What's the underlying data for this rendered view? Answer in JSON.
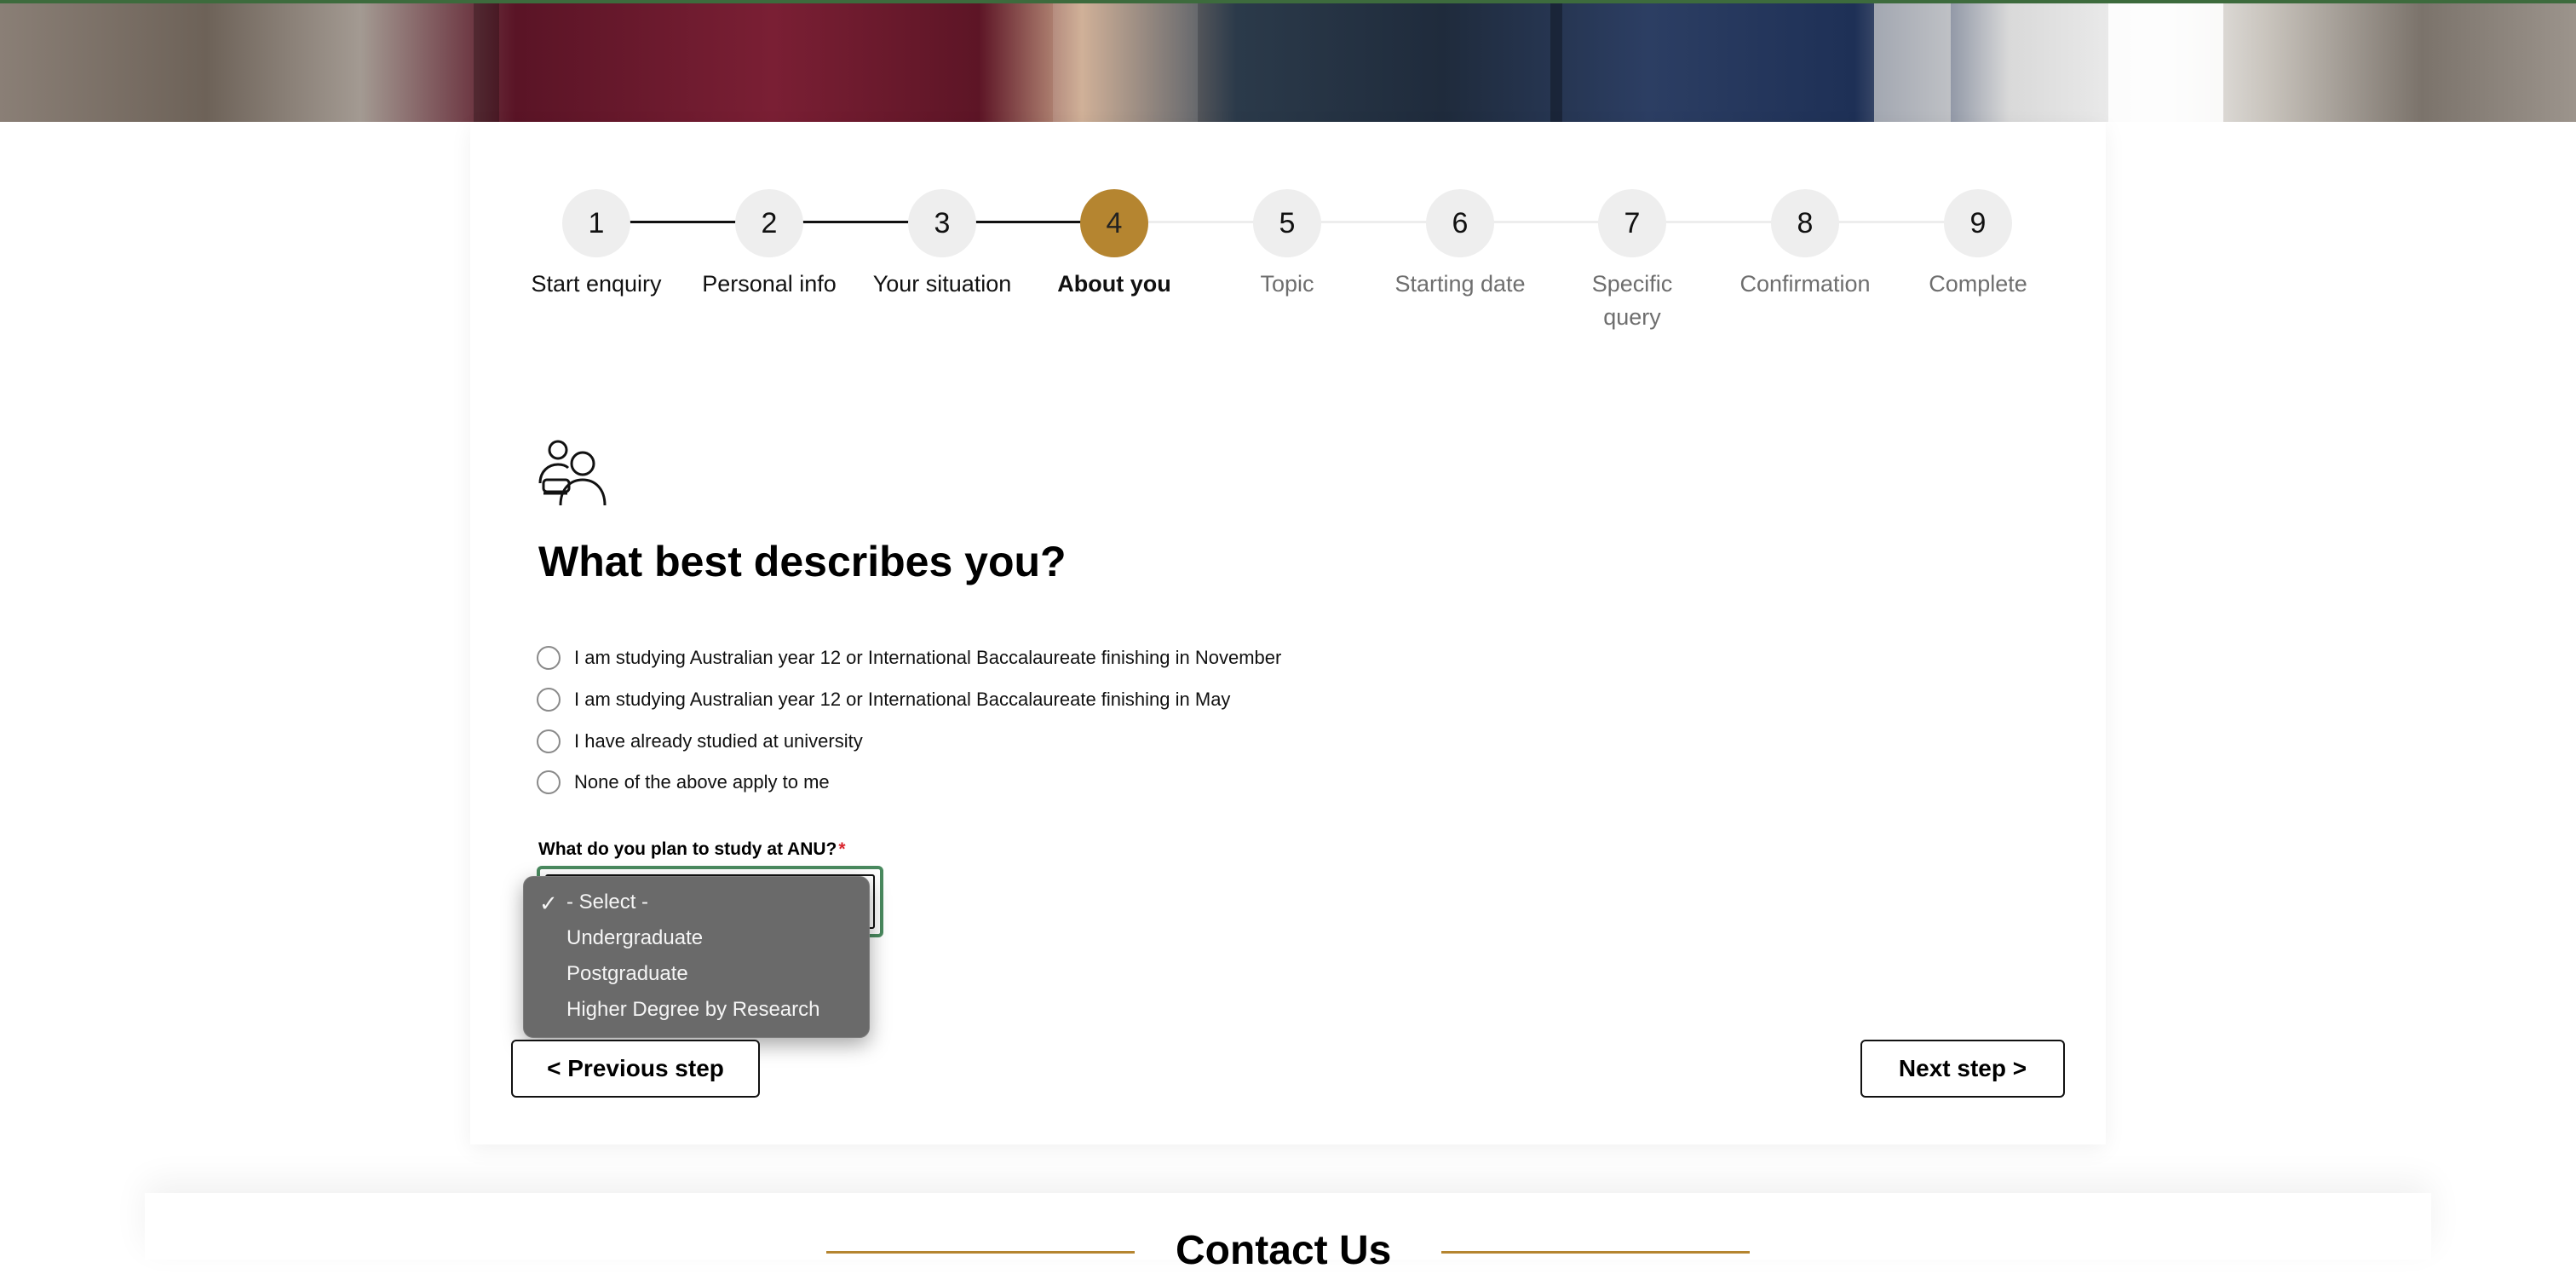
{
  "stepper": {
    "steps": [
      {
        "number": "1",
        "label": "Start enquiry",
        "state": "complete"
      },
      {
        "number": "2",
        "label": "Personal info",
        "state": "complete"
      },
      {
        "number": "3",
        "label": "Your situation",
        "state": "complete"
      },
      {
        "number": "4",
        "label": "About you",
        "state": "active"
      },
      {
        "number": "5",
        "label": "Topic",
        "state": "future"
      },
      {
        "number": "6",
        "label": "Starting date",
        "state": "future"
      },
      {
        "number": "7",
        "label": "Specific query",
        "state": "future"
      },
      {
        "number": "8",
        "label": "Confirmation",
        "state": "future"
      },
      {
        "number": "9",
        "label": "Complete",
        "state": "future"
      }
    ],
    "active_color": "#b58530"
  },
  "question": {
    "icon": "people-discussion-icon",
    "title": "What best describes you?",
    "options": [
      "I am studying Australian year 12 or International Baccalaureate finishing in November",
      "I am studying Australian year 12 or International Baccalaureate finishing in May",
      "I have already studied at university",
      "None of the above apply to me"
    ]
  },
  "study_field": {
    "label": "What do you plan to study at ANU?",
    "required_mark": "*",
    "options": [
      "- Select -",
      "Undergraduate",
      "Postgraduate",
      "Higher Degree by Research"
    ],
    "selected": "- Select -",
    "check_mark": "✓"
  },
  "nav": {
    "prev_label": "< Previous step",
    "next_label": "Next step >"
  },
  "footer": {
    "contact_title": "Contact Us"
  },
  "colors": {
    "accent_gold": "#b58530",
    "focus_green": "#4a8a5f",
    "required_red": "#d9262e"
  }
}
